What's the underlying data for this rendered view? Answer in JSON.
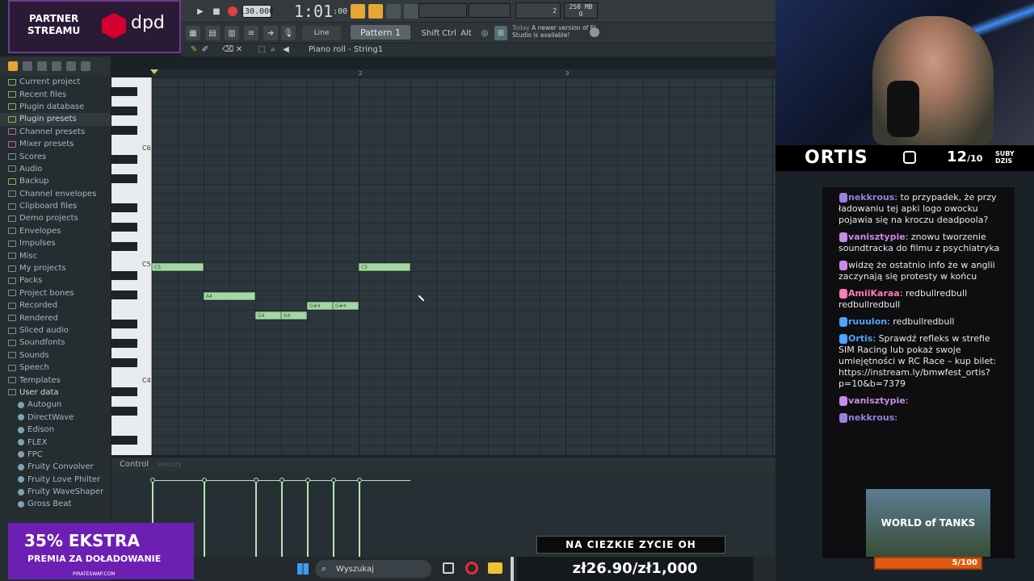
{
  "toolbar": {
    "tempo": "130.000",
    "time_main": "1:01",
    "time_sub": ":00",
    "time_label": "B:S:T",
    "cpu_top": "2",
    "mem": "258 MB",
    "cpu_bottom": "0",
    "snap": "Line",
    "pattern": "Pattern 1",
    "mod_shift": "Shift",
    "mod_ctrl": "Ctrl",
    "mod_alt": "Alt",
    "news_title": "Today",
    "news_text": "A newer version of FL Studio is available!"
  },
  "piano_roll": {
    "title": "Piano roll - String1",
    "ruler": [
      "2",
      "3"
    ],
    "key_labels": [
      "C6",
      "C5",
      "C4"
    ],
    "notes": [
      {
        "pitch": "C5",
        "label": "C5"
      },
      {
        "pitch": "A4",
        "label": "A4"
      },
      {
        "pitch": "G4",
        "label": "G4"
      },
      {
        "pitch": "G4",
        "label": "G4"
      },
      {
        "pitch": "G#4",
        "label": "G#4"
      },
      {
        "pitch": "G#4",
        "label": "G#4"
      },
      {
        "pitch": "C5",
        "label": "C5"
      }
    ],
    "control_label": "Control",
    "control_param": "Velocity"
  },
  "sidebar": {
    "items": [
      {
        "label": "Current project"
      },
      {
        "label": "Recent files"
      },
      {
        "label": "Plugin database"
      },
      {
        "label": "Plugin presets"
      },
      {
        "label": "Channel presets"
      },
      {
        "label": "Mixer presets"
      },
      {
        "label": "Scores"
      },
      {
        "label": "Audio"
      },
      {
        "label": "Backup"
      },
      {
        "label": "Channel envelopes"
      },
      {
        "label": "Clipboard files"
      },
      {
        "label": "Demo projects"
      },
      {
        "label": "Envelopes"
      },
      {
        "label": "Impulses"
      },
      {
        "label": "Misc"
      },
      {
        "label": "My projects"
      },
      {
        "label": "Packs"
      },
      {
        "label": "Project bones"
      },
      {
        "label": "Recorded"
      },
      {
        "label": "Rendered"
      },
      {
        "label": "Sliced audio"
      },
      {
        "label": "Soundfonts"
      },
      {
        "label": "Sounds"
      },
      {
        "label": "Speech"
      },
      {
        "label": "Templates"
      },
      {
        "label": "User data"
      },
      {
        "label": "Autogun"
      },
      {
        "label": "DirectWave"
      },
      {
        "label": "Edison"
      },
      {
        "label": "FLEX"
      },
      {
        "label": "FPC"
      },
      {
        "label": "Fruity Convolver"
      },
      {
        "label": "Fruity Love Philter"
      },
      {
        "label": "Fruity WaveShaper"
      },
      {
        "label": "Gross Beat"
      }
    ]
  },
  "partner": {
    "line1": "PARTNER",
    "line2": "STREAMU",
    "brand": "dpd"
  },
  "streamer": {
    "name": "ORTIS",
    "subs": "12",
    "subs_goal": "/10",
    "subs_l1": "SUBY",
    "subs_l2": "DZIS"
  },
  "chat": [
    {
      "user": "nekkrous",
      "color": "#9a7fe0",
      "text": "to przypadek, że przy ładowaniu tej apki logo owocku pojawia się na kroczu deadpoola?"
    },
    {
      "user": "vanisztypie",
      "color": "#c98be8",
      "text": "znowu tworzenie soundtracka do filmu z psychiatryka"
    },
    {
      "user": "",
      "color": "#c98be8",
      "text": "widzę że ostatnio info że w anglii zaczynają się protesty w końcu"
    },
    {
      "user": "AmiiKaraa",
      "color": "#ff7ab6",
      "text": "redbullredbull redbullredbull"
    },
    {
      "user": "ruuulon",
      "color": "#4fa3ff",
      "text": "redbullredbull"
    },
    {
      "user": "Ortis",
      "color": "#4fa3ff",
      "text": "Sprawdź refleks w strefie SIM Racing lub pokaż swoje umiejętności w RC Race – kup bilet: https://instream.ly/bmwfest_ortis?p=10&b=7379"
    },
    {
      "user": "vanisztypie",
      "color": "#c98be8",
      "text": ""
    },
    {
      "user": "nekkrous",
      "color": "#9a7fe0",
      "text": ""
    }
  ],
  "wot_banner": "WORLD of TANKS",
  "goal": "5/100",
  "promo": {
    "big": "35% EKSTRA",
    "small": "PREMIA ZA DOŁADOWANIE",
    "url": "PIRATESWAP.COM"
  },
  "taskbar": {
    "search": "Wyszukaj"
  },
  "alert": {
    "title": "NA CIEZKIE ZYCIE OH",
    "amount": "zł26.90/zł1,000"
  }
}
